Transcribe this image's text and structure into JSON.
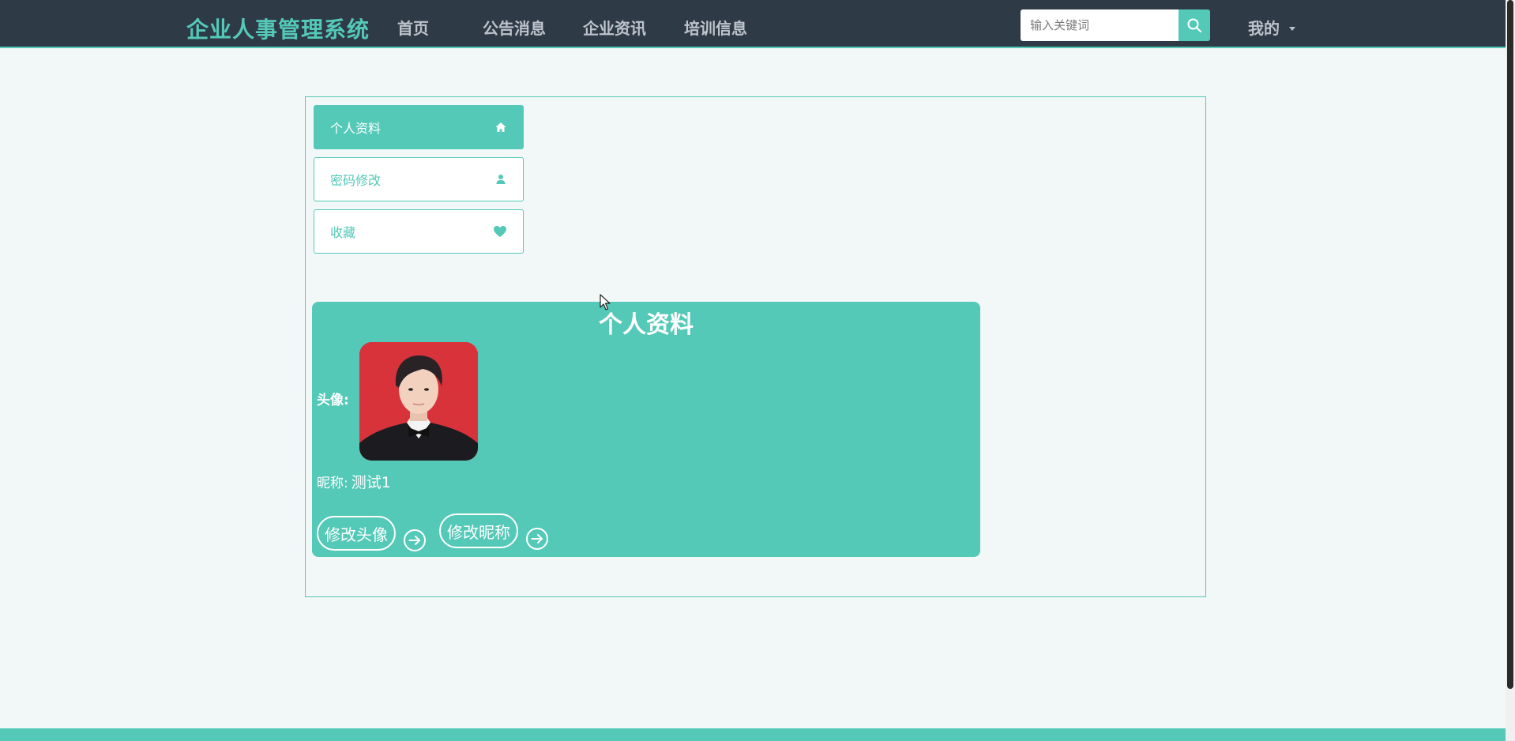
{
  "header": {
    "brand": "企业人事管理系统",
    "nav": [
      {
        "label": "首页"
      },
      {
        "label": "公告消息"
      },
      {
        "label": "企业资讯"
      },
      {
        "label": "培训信息"
      }
    ],
    "search": {
      "placeholder": "输入关键词",
      "value": ""
    },
    "user_menu": "我的"
  },
  "sidebar": {
    "items": [
      {
        "label": "个人资料",
        "icon": "home-icon",
        "active": true
      },
      {
        "label": "密码修改",
        "icon": "user-icon",
        "active": false
      },
      {
        "label": "收藏",
        "icon": "heart-icon",
        "active": false
      }
    ]
  },
  "profile": {
    "title": "个人资料",
    "avatar_label": "头像:",
    "nickname_label": "昵称:",
    "nickname_value": "测试1",
    "change_avatar_button": "修改头像",
    "change_nickname_button": "修改昵称"
  },
  "colors": {
    "accent": "#54c9b7",
    "header_bg": "#2f3a47",
    "page_bg": "#f2f7f8",
    "avatar_bg": "#d8333b"
  }
}
